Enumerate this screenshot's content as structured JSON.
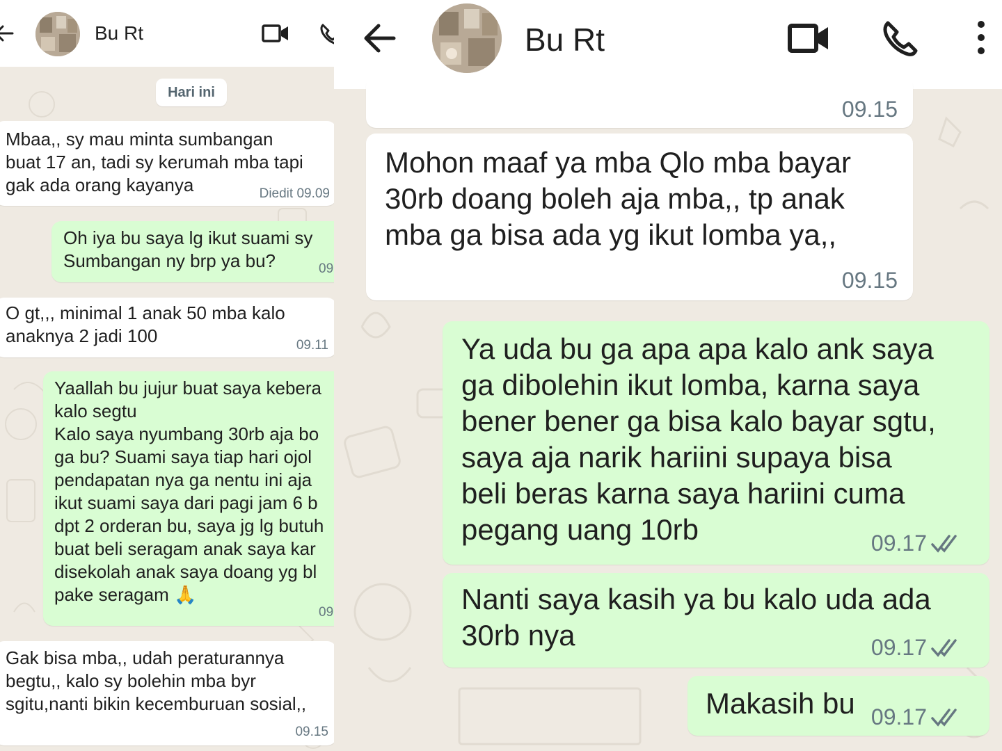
{
  "contact": {
    "name": "Bu Rt"
  },
  "left": {
    "date_chip": "Hari ini",
    "messages": [
      {
        "dir": "in",
        "text": "Mbaa,, sy mau minta sumbangan\nbuat 17 an, tadi sy kerumah mba tapi\ngak ada orang kayanya",
        "meta": "Diedit 09.09"
      },
      {
        "dir": "out",
        "text": "Oh iya bu saya lg ikut suami sy\nSumbangan ny brp ya bu?",
        "meta": "09"
      },
      {
        "dir": "in",
        "text": "O gt,,, minimal 1 anak 50 mba kalo\nanaknya 2 jadi 100",
        "meta": "09.11"
      },
      {
        "dir": "out",
        "text": "Yaallah bu jujur buat saya kebera\nkalo segtu\nKalo saya nyumbang 30rb aja bo\nga bu? Suami saya tiap hari ojol\npendapatan nya ga nentu ini aja\nikut suami saya dari pagi jam 6 b\ndpt 2 orderan bu, saya jg lg butuh\nbuat beli seragam anak saya kar\ndisekolah anak saya doang yg bl\npake seragam 🙏",
        "meta": "09"
      },
      {
        "dir": "in",
        "text": "Gak bisa mba,, udah peraturannya\nbegtu,, kalo sy bolehin mba byr\nsgitu,nanti bikin kecemburuan sosial,,",
        "meta": "09.15"
      }
    ]
  },
  "right": {
    "top_meta": "09.15",
    "messages": [
      {
        "dir": "in",
        "text": "Mohon maaf ya mba Qlo mba bayar\n30rb doang boleh aja mba,, tp anak\nmba ga bisa ada yg ikut lomba ya,,",
        "meta": "09.15"
      },
      {
        "dir": "out",
        "text": "Ya uda bu ga apa apa kalo ank saya\nga dibolehin ikut lomba, karna saya\nbener bener ga bisa kalo bayar sgtu,\nsaya aja narik hariini supaya bisa\nbeli beras karna saya hariini cuma\npegang uang 10rb",
        "meta": "09.17"
      },
      {
        "dir": "out",
        "text": "Nanti saya kasih ya bu kalo uda ada\n30rb nya",
        "meta": "09.17"
      },
      {
        "dir": "out",
        "text": "Makasih bu",
        "meta": "09.17"
      }
    ]
  },
  "icons": [
    "back-arrow-icon",
    "video-call-icon",
    "voice-call-icon",
    "more-options-icon",
    "double-check-icon"
  ],
  "colors": {
    "incoming": "#ffffff",
    "outgoing": "#d9fdd3",
    "wallpaper": "#efeae2",
    "read_ticks": "#53bdeb",
    "meta_text": "#667781"
  }
}
